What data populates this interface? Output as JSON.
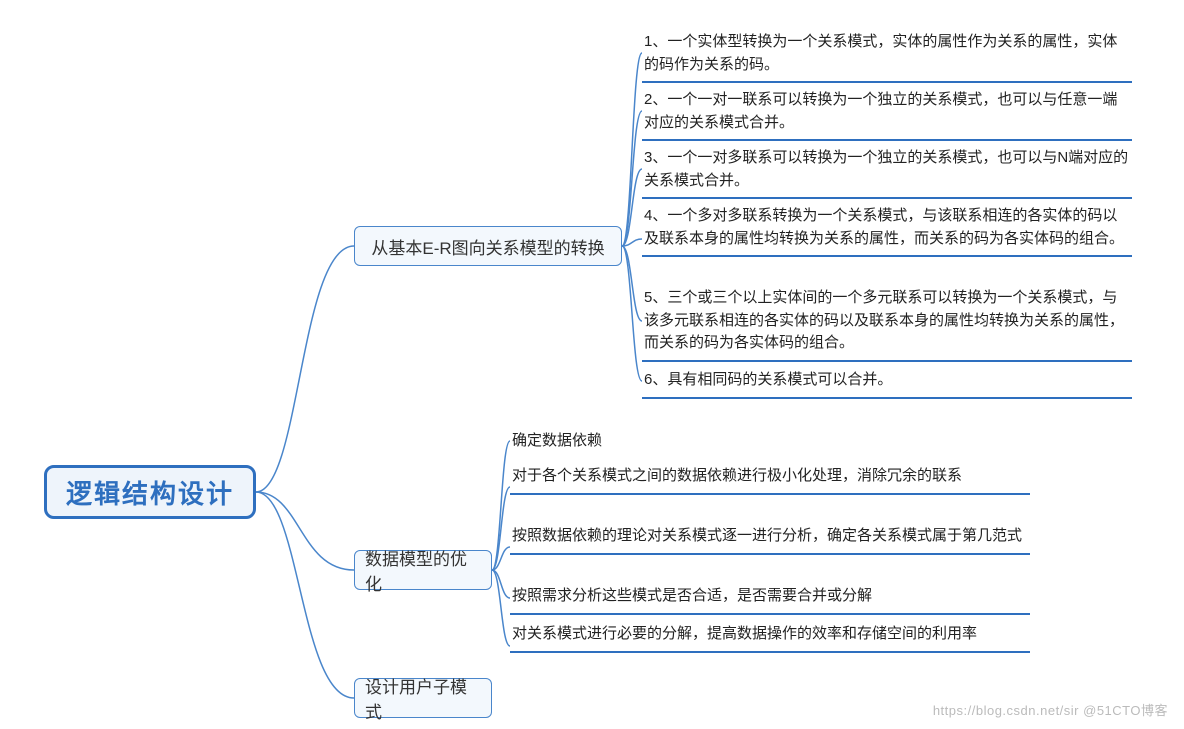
{
  "root": {
    "label": "逻辑结构设计"
  },
  "branches": [
    {
      "key": "er",
      "label": "从基本E-R图向关系模型的转换",
      "children": [
        "1、一个实体型转换为一个关系模式，实体的属性作为关系的属性，实体的码作为关系的码。",
        "2、一个一对一联系可以转换为一个独立的关系模式，也可以与任意一端对应的关系模式合并。",
        "3、一个一对多联系可以转换为一个独立的关系模式，也可以与N端对应的关系模式合并。",
        "4、一个多对多联系转换为一个关系模式，与该联系相连的各实体的码以及联系本身的属性均转换为关系的属性，而关系的码为各实体码的组合。",
        "5、三个或三个以上实体间的一个多元联系可以转换为一个关系模式，与该多元联系相连的各实体的码以及联系本身的属性均转换为关系的属性，而关系的码为各实体码的组合。",
        "6、具有相同码的关系模式可以合并。"
      ]
    },
    {
      "key": "opt",
      "label": "数据模型的优化",
      "children": [
        "确定数据依赖",
        "对于各个关系模式之间的数据依赖进行极小化处理，消除冗余的联系",
        "按照数据依赖的理论对关系模式逐一进行分析，确定各关系模式属于第几范式",
        "按照需求分析这些模式是否合适，是否需要合并或分解",
        "对关系模式进行必要的分解，提高数据操作的效率和存储空间的利用率"
      ]
    },
    {
      "key": "subschema",
      "label": "设计用户子模式",
      "children": []
    }
  ],
  "watermark": "https://blog.csdn.net/sir @51CTO博客"
}
